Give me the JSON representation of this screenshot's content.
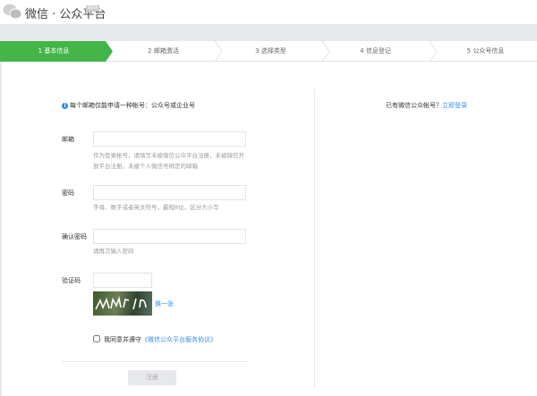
{
  "header": {
    "title": "微信 · 公众平台",
    "badge": "beta"
  },
  "steps": [
    {
      "label": "1 基本信息",
      "active": true
    },
    {
      "label": "2 邮箱激活",
      "active": false
    },
    {
      "label": "3 选择类型",
      "active": false
    },
    {
      "label": "4 信息登记",
      "active": false
    },
    {
      "label": "5 公众号信息",
      "active": false
    }
  ],
  "colors": {
    "active_step": "#44b549",
    "link": "#3a8ee6"
  },
  "notice": "每个邮箱仅能申请一种帐号：公众号或企业号",
  "login_prompt": {
    "text": "已有微信公众帐号？",
    "link": "立即登录"
  },
  "form": {
    "email": {
      "label": "邮箱",
      "value": "",
      "hint": "作为登录帐号，请填写未被微信公众平台注册，未被微信开放平台注册，未被个人微信号绑定的邮箱"
    },
    "password": {
      "label": "密码",
      "value": "",
      "hint": "字母、数字或者英文符号，最短8位，区分大小写"
    },
    "confirm": {
      "label": "确认密码",
      "value": "",
      "hint": "请再次输入密码"
    },
    "captcha": {
      "label": "验证码",
      "value": "",
      "refresh": "换一张",
      "image_text": "wMY h"
    },
    "agree": {
      "text": "我同意并遵守",
      "link": "《微信公众平台服务协议》",
      "checked": false
    },
    "submit": "注册"
  }
}
